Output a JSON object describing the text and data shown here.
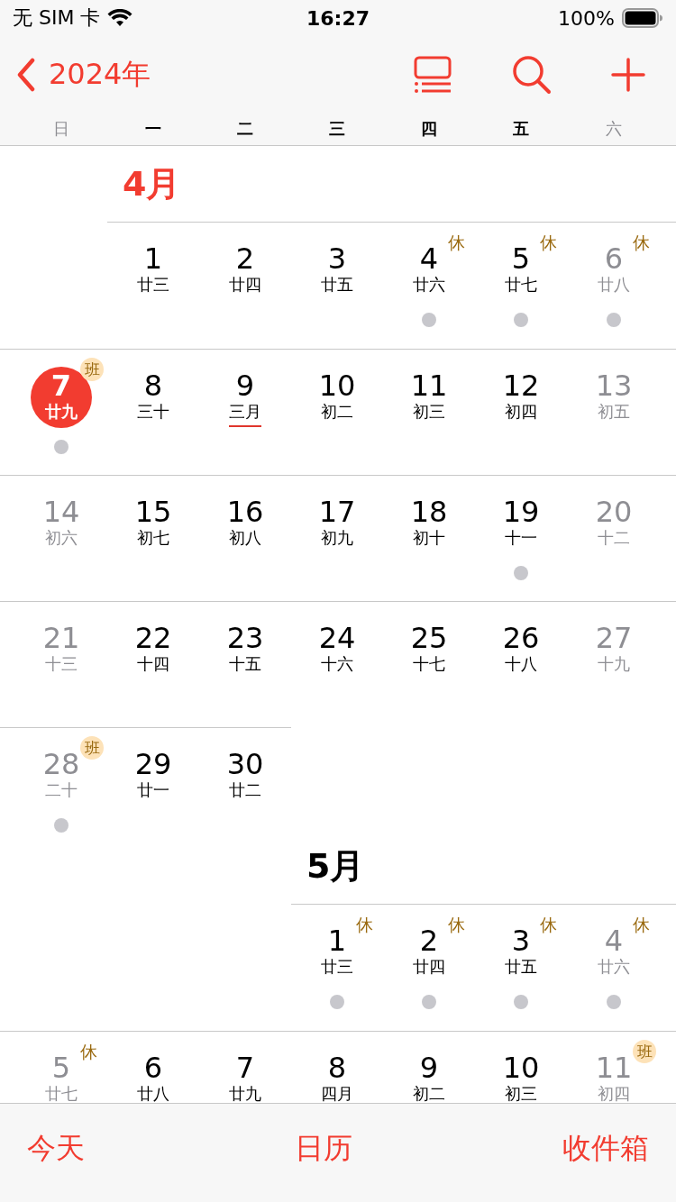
{
  "status_bar": {
    "carrier": "无 SIM 卡",
    "time": "16:27",
    "battery": "100%"
  },
  "nav": {
    "back_label": "2024年"
  },
  "weekdays": [
    {
      "label": "日",
      "dimmed": true
    },
    {
      "label": "一",
      "dimmed": false
    },
    {
      "label": "二",
      "dimmed": false
    },
    {
      "label": "三",
      "dimmed": false
    },
    {
      "label": "四",
      "dimmed": false
    },
    {
      "label": "五",
      "dimmed": false
    },
    {
      "label": "六",
      "dimmed": true
    }
  ],
  "months": [
    {
      "title": "4月",
      "current": true,
      "weeks": [
        {
          "days": [
            {
              "kind": "blank"
            },
            {
              "kind": "day",
              "day": "1",
              "lunar": "廿三",
              "dimmed": false,
              "today": false,
              "dot": false,
              "lunar_month": false
            },
            {
              "kind": "day",
              "day": "2",
              "lunar": "廿四",
              "dimmed": false,
              "today": false,
              "dot": false,
              "lunar_month": false
            },
            {
              "kind": "day",
              "day": "3",
              "lunar": "廿五",
              "dimmed": false,
              "today": false,
              "dot": false,
              "lunar_month": false
            },
            {
              "kind": "day",
              "day": "4",
              "lunar": "廿六",
              "dimmed": false,
              "today": false,
              "dot": true,
              "lunar_month": false,
              "badge": {
                "text": "休",
                "kind": "rest"
              }
            },
            {
              "kind": "day",
              "day": "5",
              "lunar": "廿七",
              "dimmed": false,
              "today": false,
              "dot": true,
              "lunar_month": false,
              "badge": {
                "text": "休",
                "kind": "rest"
              }
            },
            {
              "kind": "day",
              "day": "6",
              "lunar": "廿八",
              "dimmed": true,
              "today": false,
              "dot": true,
              "lunar_month": false,
              "badge": {
                "text": "休",
                "kind": "rest"
              }
            }
          ]
        },
        {
          "days": [
            {
              "kind": "day",
              "day": "7",
              "lunar": "廿九",
              "dimmed": true,
              "today": true,
              "dot": true,
              "lunar_month": false,
              "badge": {
                "text": "班",
                "kind": "work"
              }
            },
            {
              "kind": "day",
              "day": "8",
              "lunar": "三十",
              "dimmed": false,
              "today": false,
              "dot": false,
              "lunar_month": false
            },
            {
              "kind": "day",
              "day": "9",
              "lunar": "三月",
              "dimmed": false,
              "today": false,
              "dot": false,
              "lunar_month": true
            },
            {
              "kind": "day",
              "day": "10",
              "lunar": "初二",
              "dimmed": false,
              "today": false,
              "dot": false,
              "lunar_month": false
            },
            {
              "kind": "day",
              "day": "11",
              "lunar": "初三",
              "dimmed": false,
              "today": false,
              "dot": false,
              "lunar_month": false
            },
            {
              "kind": "day",
              "day": "12",
              "lunar": "初四",
              "dimmed": false,
              "today": false,
              "dot": false,
              "lunar_month": false
            },
            {
              "kind": "day",
              "day": "13",
              "lunar": "初五",
              "dimmed": true,
              "today": false,
              "dot": false,
              "lunar_month": false
            }
          ]
        },
        {
          "days": [
            {
              "kind": "day",
              "day": "14",
              "lunar": "初六",
              "dimmed": true,
              "today": false,
              "dot": false,
              "lunar_month": false
            },
            {
              "kind": "day",
              "day": "15",
              "lunar": "初七",
              "dimmed": false,
              "today": false,
              "dot": false,
              "lunar_month": false
            },
            {
              "kind": "day",
              "day": "16",
              "lunar": "初八",
              "dimmed": false,
              "today": false,
              "dot": false,
              "lunar_month": false
            },
            {
              "kind": "day",
              "day": "17",
              "lunar": "初九",
              "dimmed": false,
              "today": false,
              "dot": false,
              "lunar_month": false
            },
            {
              "kind": "day",
              "day": "18",
              "lunar": "初十",
              "dimmed": false,
              "today": false,
              "dot": false,
              "lunar_month": false
            },
            {
              "kind": "day",
              "day": "19",
              "lunar": "十一",
              "dimmed": false,
              "today": false,
              "dot": true,
              "lunar_month": false
            },
            {
              "kind": "day",
              "day": "20",
              "lunar": "十二",
              "dimmed": true,
              "today": false,
              "dot": false,
              "lunar_month": false
            }
          ]
        },
        {
          "days": [
            {
              "kind": "day",
              "day": "21",
              "lunar": "十三",
              "dimmed": true,
              "today": false,
              "dot": false,
              "lunar_month": false
            },
            {
              "kind": "day",
              "day": "22",
              "lunar": "十四",
              "dimmed": false,
              "today": false,
              "dot": false,
              "lunar_month": false
            },
            {
              "kind": "day",
              "day": "23",
              "lunar": "十五",
              "dimmed": false,
              "today": false,
              "dot": false,
              "lunar_month": false
            },
            {
              "kind": "day",
              "day": "24",
              "lunar": "十六",
              "dimmed": false,
              "today": false,
              "dot": false,
              "lunar_month": false
            },
            {
              "kind": "day",
              "day": "25",
              "lunar": "十七",
              "dimmed": false,
              "today": false,
              "dot": false,
              "lunar_month": false
            },
            {
              "kind": "day",
              "day": "26",
              "lunar": "十八",
              "dimmed": false,
              "today": false,
              "dot": false,
              "lunar_month": false
            },
            {
              "kind": "day",
              "day": "27",
              "lunar": "十九",
              "dimmed": true,
              "today": false,
              "dot": false,
              "lunar_month": false
            }
          ]
        },
        {
          "days": [
            {
              "kind": "day",
              "day": "28",
              "lunar": "二十",
              "dimmed": true,
              "today": false,
              "dot": true,
              "lunar_month": false,
              "badge": {
                "text": "班",
                "kind": "work"
              }
            },
            {
              "kind": "day",
              "day": "29",
              "lunar": "廿一",
              "dimmed": false,
              "today": false,
              "dot": false,
              "lunar_month": false
            },
            {
              "kind": "day",
              "day": "30",
              "lunar": "廿二",
              "dimmed": false,
              "today": false,
              "dot": false,
              "lunar_month": false
            },
            {
              "kind": "blank"
            },
            {
              "kind": "blank"
            },
            {
              "kind": "blank"
            },
            {
              "kind": "blank"
            }
          ]
        }
      ]
    },
    {
      "title": "5月",
      "current": false,
      "weeks": [
        {
          "days": [
            {
              "kind": "blank"
            },
            {
              "kind": "blank"
            },
            {
              "kind": "blank"
            },
            {
              "kind": "day",
              "day": "1",
              "lunar": "廿三",
              "dimmed": false,
              "today": false,
              "dot": true,
              "lunar_month": false,
              "badge": {
                "text": "休",
                "kind": "rest"
              }
            },
            {
              "kind": "day",
              "day": "2",
              "lunar": "廿四",
              "dimmed": false,
              "today": false,
              "dot": true,
              "lunar_month": false,
              "badge": {
                "text": "休",
                "kind": "rest"
              }
            },
            {
              "kind": "day",
              "day": "3",
              "lunar": "廿五",
              "dimmed": false,
              "today": false,
              "dot": true,
              "lunar_month": false,
              "badge": {
                "text": "休",
                "kind": "rest"
              }
            },
            {
              "kind": "day",
              "day": "4",
              "lunar": "廿六",
              "dimmed": true,
              "today": false,
              "dot": true,
              "lunar_month": false,
              "badge": {
                "text": "休",
                "kind": "rest"
              }
            }
          ]
        },
        {
          "days": [
            {
              "kind": "day",
              "day": "5",
              "lunar": "廿七",
              "dimmed": true,
              "today": false,
              "dot": false,
              "lunar_month": false,
              "badge": {
                "text": "休",
                "kind": "rest"
              }
            },
            {
              "kind": "day",
              "day": "6",
              "lunar": "廿八",
              "dimmed": false,
              "today": false,
              "dot": false,
              "lunar_month": false
            },
            {
              "kind": "day",
              "day": "7",
              "lunar": "廿九",
              "dimmed": false,
              "today": false,
              "dot": false,
              "lunar_month": false
            },
            {
              "kind": "day",
              "day": "8",
              "lunar": "四月",
              "dimmed": false,
              "today": false,
              "dot": false,
              "lunar_month": true
            },
            {
              "kind": "day",
              "day": "9",
              "lunar": "初二",
              "dimmed": false,
              "today": false,
              "dot": false,
              "lunar_month": false
            },
            {
              "kind": "day",
              "day": "10",
              "lunar": "初三",
              "dimmed": false,
              "today": false,
              "dot": false,
              "lunar_month": false
            },
            {
              "kind": "day",
              "day": "11",
              "lunar": "初四",
              "dimmed": true,
              "today": false,
              "dot": false,
              "lunar_month": false,
              "badge": {
                "text": "班",
                "kind": "work"
              }
            }
          ]
        }
      ]
    }
  ],
  "tab_bar": [
    "今天",
    "日历",
    "收件箱"
  ]
}
